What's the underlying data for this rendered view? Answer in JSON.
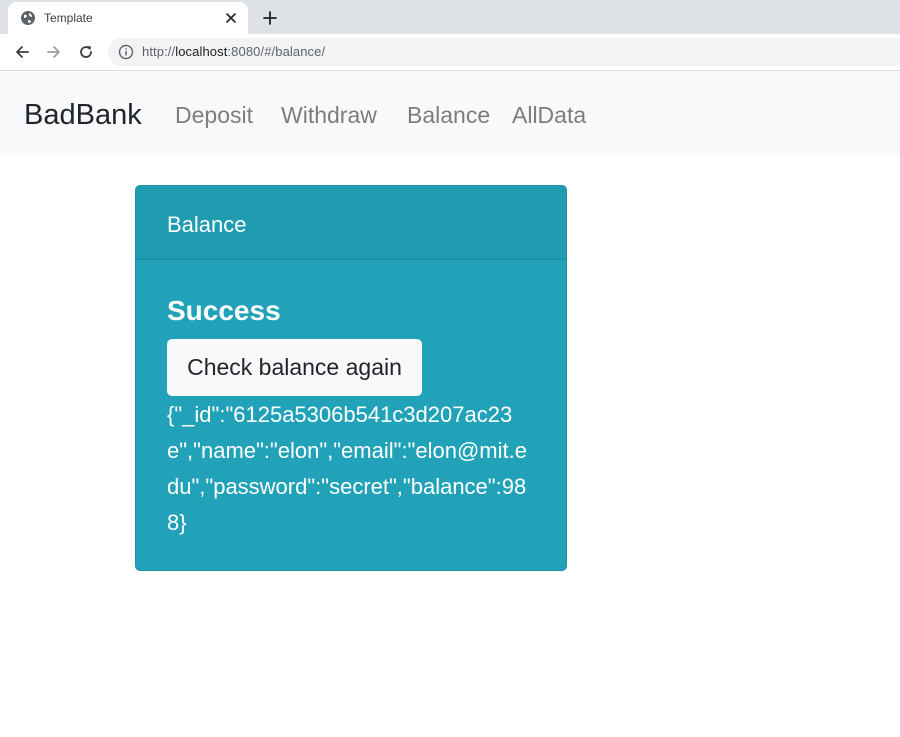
{
  "browser": {
    "tab": {
      "title": "Template"
    },
    "address": {
      "url_prefix": "http://",
      "host": "localhost",
      "url_rest": ":8080/#/balance/"
    }
  },
  "navbar": {
    "brand": "BadBank",
    "links": [
      "Deposit",
      "Withdraw",
      "Balance",
      "AllData"
    ]
  },
  "card": {
    "header": "Balance",
    "status": "Success",
    "button_label": "Check balance again",
    "result": "{\"_id\":\"6125a5306b541c3d207ac23e\",\"name\":\"elon\",\"email\":\"elon@mit.edu\",\"password\":\"secret\",\"balance\":988}"
  },
  "colors": {
    "card_bg": "#22a2b8",
    "navbar_bg": "#f8f9fa",
    "button_bg": "#f8f9fa"
  },
  "icons": [
    "globe-icon",
    "close-icon",
    "plus-icon",
    "back-arrow-icon",
    "forward-arrow-icon",
    "reload-icon",
    "info-icon"
  ]
}
